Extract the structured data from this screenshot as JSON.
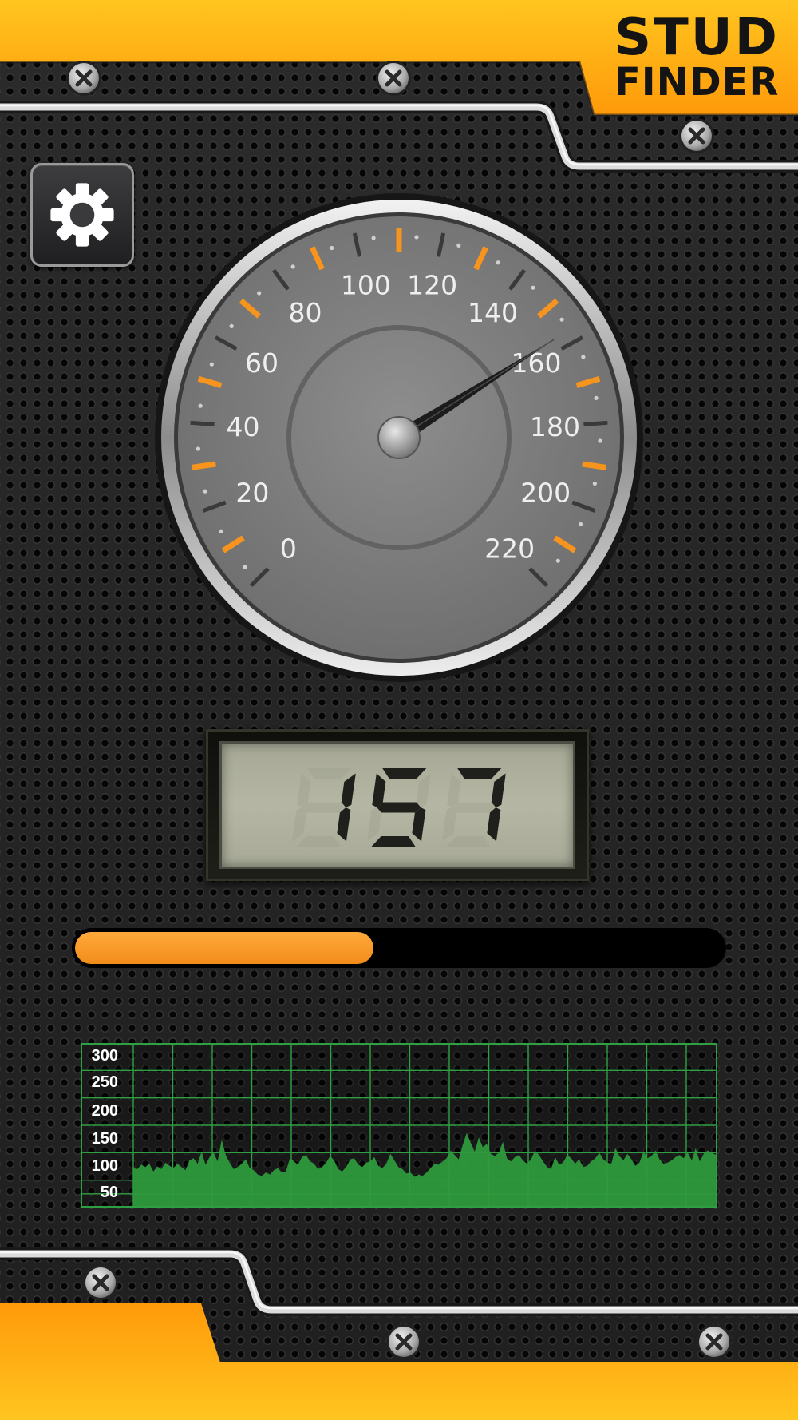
{
  "header": {
    "title_line1": "STUD",
    "title_line2": "FINDER"
  },
  "icons": {
    "settings": "gear-icon",
    "screws": "screw-icon"
  },
  "colors": {
    "accent": "#f7941d",
    "background": "#242424",
    "graph_line": "#2ea043",
    "graph_fill": "#2e9a3c",
    "lcd_background": "#b1b3a0"
  },
  "gauge": {
    "tick_labels": [
      "0",
      "20",
      "40",
      "60",
      "80",
      "100",
      "120",
      "140",
      "160",
      "180",
      "200",
      "220"
    ],
    "min": 0,
    "max": 220,
    "value": 157
  },
  "lcd": {
    "reading": "157"
  },
  "progress": {
    "fraction": 0.46
  },
  "graph": {
    "y_labels": [
      "300",
      "250",
      "200",
      "150",
      "100",
      "50"
    ],
    "y_max": 300,
    "samples": [
      72,
      70,
      78,
      74,
      80,
      66,
      75,
      70,
      82,
      76,
      72,
      80,
      74,
      68,
      86,
      90,
      80,
      102,
      78,
      92,
      100,
      84,
      124,
      96,
      82,
      70,
      74,
      80,
      88,
      72,
      68,
      60,
      58,
      64,
      60,
      68,
      72,
      64,
      66,
      90,
      84,
      78,
      92,
      96,
      84,
      80,
      70,
      74,
      82,
      94,
      86,
      70,
      66,
      74,
      88,
      90,
      78,
      74,
      82,
      84,
      92,
      76,
      72,
      80,
      98,
      86,
      74,
      70,
      62,
      64,
      56,
      60,
      58,
      64,
      72,
      80,
      78,
      84,
      90,
      104,
      96,
      88,
      114,
      136,
      118,
      102,
      128,
      110,
      116,
      98,
      94,
      100,
      120,
      90,
      84,
      92,
      96,
      86,
      80,
      88,
      104,
      96,
      84,
      74,
      70,
      92,
      78,
      82,
      96,
      90,
      80,
      88,
      74,
      76,
      84,
      90,
      100,
      88,
      82,
      80,
      108,
      94,
      86,
      98,
      88,
      76,
      82,
      102,
      90,
      94,
      104,
      88,
      80,
      82,
      86,
      92,
      96,
      90,
      100,
      86,
      108,
      84,
      98,
      104,
      100,
      96
    ]
  }
}
